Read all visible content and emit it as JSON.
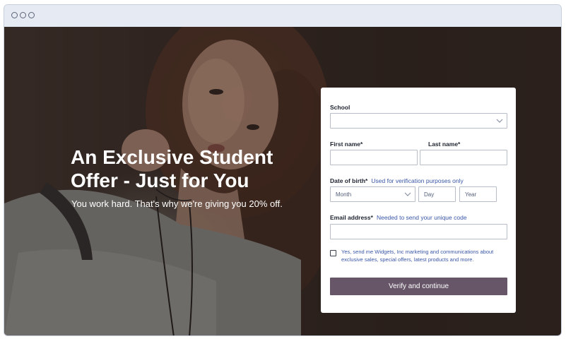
{
  "hero": {
    "headline": "An Exclusive Student Offer - Just for You",
    "subline": "You work hard. That's why we're giving you 20% off."
  },
  "form": {
    "school": {
      "label": "School",
      "value": ""
    },
    "first_name": {
      "label": "First name*",
      "value": ""
    },
    "last_name": {
      "label": "Last name*",
      "value": ""
    },
    "dob": {
      "label": "Date of birth*",
      "hint": "Used for verification purposes only",
      "month_placeholder": "Month",
      "day_placeholder": "Day",
      "year_placeholder": "Year"
    },
    "email": {
      "label": "Email address*",
      "hint": "Needed to send your unique code",
      "value": ""
    },
    "consent": {
      "checked": false,
      "text": "Yes, send me Widgets, Inc marketing and communications about exclusive sales, special offers, latest products and more."
    },
    "submit_label": "Verify and continue"
  },
  "colors": {
    "button": "#665668",
    "hint_text": "#3a57a6",
    "chrome": "#e6ebf3"
  },
  "icons": [
    "window-dot-icon",
    "chevron-down-icon",
    "checkbox-icon"
  ]
}
